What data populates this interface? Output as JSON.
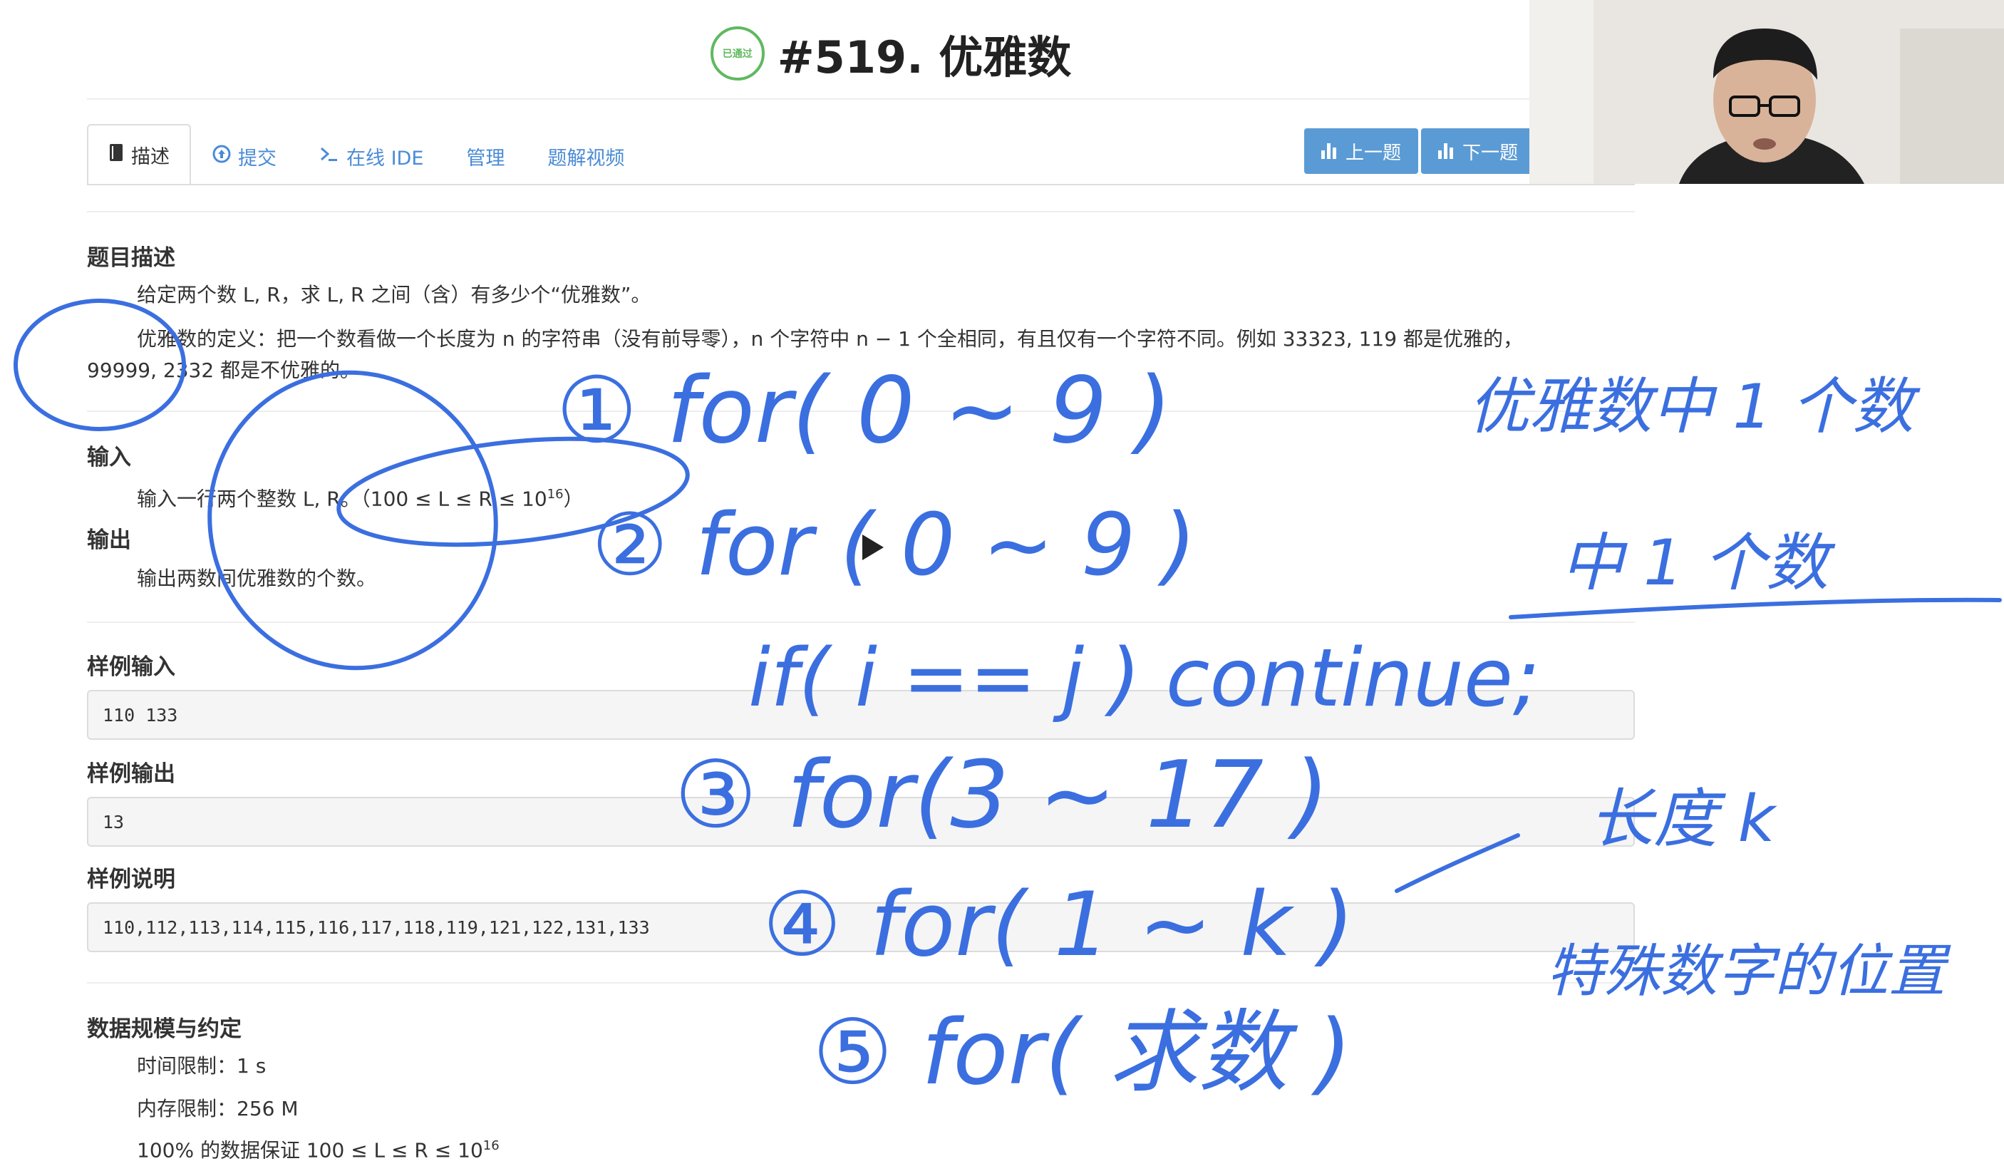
{
  "problem": {
    "status_badge": "已通过",
    "title": "#519. 优雅数"
  },
  "tabs": [
    {
      "label": "描述",
      "icon": "book-icon"
    },
    {
      "label": "提交",
      "icon": "upload-icon"
    },
    {
      "label": "在线 IDE",
      "icon": "terminal-icon"
    },
    {
      "label": "管理"
    },
    {
      "label": "题解视频"
    }
  ],
  "nav": {
    "prev": "上一题",
    "next": "下一题"
  },
  "description": {
    "heading": "题目描述",
    "line1": "给定两个数 L, R，求 L, R 之间（含）有多少个“优雅数”。",
    "line2": "优雅数的定义：把一个数看做一个长度为 n 的字符串（没有前导零），n 个字符中 n − 1 个全相同，有且仅有一个字符不同。例如 33323, 119 都是优雅的，",
    "line3": "99999, 2332 都是不优雅的。"
  },
  "input": {
    "heading": "输入",
    "text": "输入一行两个整数 L, R。（100 ≤ L ≤ R ≤ 10",
    "sup": "16",
    "close": "）"
  },
  "output": {
    "heading": "输出",
    "text": "输出两数间优雅数的个数。"
  },
  "samples": {
    "in_heading": "样例输入",
    "in_value": "110 133",
    "out_heading": "样例输出",
    "out_value": "13",
    "explain_heading": "样例说明",
    "explain_value": "110,112,113,114,115,116,117,118,119,121,122,131,133"
  },
  "limits": {
    "heading": "数据规模与约定",
    "time": "时间限制：1 s",
    "memory": "内存限制：256 M",
    "partial": "100% 的数据保证 100 ≤ L ≤ R ≤ 10",
    "partial_sup": "16"
  },
  "handwriting": {
    "l1": "① for( 0 ~ 9 )",
    "l2": "② for ( 0 ~ 9 )",
    "l3": "if( i == j ) continue;",
    "l4": "③ for(3 ~ 17 )",
    "l5": "④ for( 1 ~ k )",
    "l6": "⑤ for( 求数 )",
    "r1": "优雅数中 1 个数",
    "r2": "中 1 个数",
    "r3": "长度 k",
    "r4": "特殊数字的位置"
  },
  "colors": {
    "accent": "#5b9bd5",
    "ink": "#3b6fe0",
    "link": "#4a8bd6",
    "badge": "#5fb95f"
  }
}
